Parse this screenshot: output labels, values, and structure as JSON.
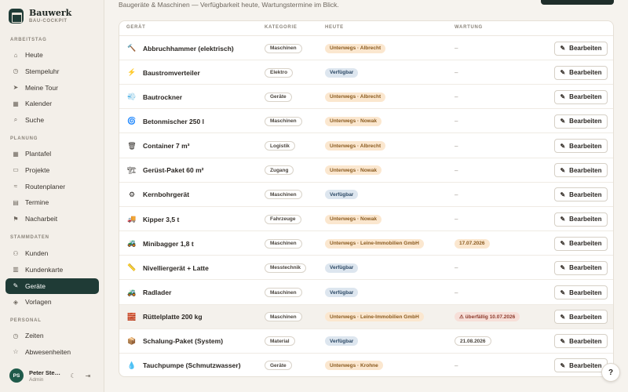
{
  "brand": {
    "title": "Bauwerk",
    "subtitle": "BAU-COCKPIT",
    "logo_icon": "building-icon"
  },
  "sidebar": {
    "sections": [
      {
        "label": "ARBEITSTAG",
        "items": [
          {
            "label": "Heute",
            "icon": "home-icon",
            "glyph": "⌂"
          },
          {
            "label": "Stempeluhr",
            "icon": "clock-icon",
            "glyph": "◷"
          },
          {
            "label": "Meine Tour",
            "icon": "send-icon",
            "glyph": "➤"
          },
          {
            "label": "Kalender",
            "icon": "calendar-icon",
            "glyph": "▦"
          },
          {
            "label": "Suche",
            "icon": "search-icon",
            "glyph": "⌕"
          }
        ]
      },
      {
        "label": "PLANUNG",
        "items": [
          {
            "label": "Plantafel",
            "icon": "grid-icon",
            "glyph": "▦"
          },
          {
            "label": "Projekte",
            "icon": "folder-icon",
            "glyph": "▭"
          },
          {
            "label": "Routenplaner",
            "icon": "route-icon",
            "glyph": "≈"
          },
          {
            "label": "Termine",
            "icon": "document-icon",
            "glyph": "▤"
          },
          {
            "label": "Nacharbeit",
            "icon": "flag-icon",
            "glyph": "⚑"
          }
        ]
      },
      {
        "label": "STAMMDATEN",
        "items": [
          {
            "label": "Kunden",
            "icon": "users-icon",
            "glyph": "⚇"
          },
          {
            "label": "Kundenkarte",
            "icon": "map-icon",
            "glyph": "▥"
          },
          {
            "label": "Geräte",
            "icon": "wrench-icon",
            "glyph": "✎",
            "active": true
          },
          {
            "label": "Vorlagen",
            "icon": "layers-icon",
            "glyph": "◈"
          }
        ]
      },
      {
        "label": "PERSONAL",
        "items": [
          {
            "label": "Zeiten",
            "icon": "clock-icon",
            "glyph": "◷"
          },
          {
            "label": "Abwesenheiten",
            "icon": "star-icon",
            "glyph": "☆"
          }
        ]
      }
    ]
  },
  "user": {
    "initials": "PS",
    "name": "Peter Ste…",
    "role": "Admin",
    "theme_icon": "moon-icon",
    "logout_icon": "logout-icon"
  },
  "intro": "Baugeräte & Maschinen — Verfügbarkeit heute, Wartungstermine im Blick.",
  "table": {
    "headers": {
      "device": "GERÄT",
      "category": "KATEGORIE",
      "today": "HEUTE",
      "maintenance": "WARTUNG"
    },
    "edit_label": "Bearbeiten",
    "rows": [
      {
        "icon": "🔨",
        "icon_name": "hammer-icon",
        "name": "Abbruchhammer (elektrisch)",
        "category": "Maschinen",
        "status": "Unterwegs · Albrecht",
        "status_type": "away",
        "maintenance": "–",
        "maint_type": "none"
      },
      {
        "icon": "⚡",
        "icon_name": "lightning-icon",
        "name": "Baustromverteiler",
        "category": "Elektro",
        "status": "Verfügbar",
        "status_type": "free",
        "maintenance": "–",
        "maint_type": "none"
      },
      {
        "icon": "💨",
        "icon_name": "dryer-icon",
        "name": "Bautrockner",
        "category": "Geräte",
        "status": "Unterwegs · Albrecht",
        "status_type": "away",
        "maintenance": "–",
        "maint_type": "none"
      },
      {
        "icon": "🌀",
        "icon_name": "mixer-icon",
        "name": "Betonmischer 250 l",
        "category": "Maschinen",
        "status": "Unterwegs · Nowak",
        "status_type": "away",
        "maintenance": "–",
        "maint_type": "none"
      },
      {
        "icon": "🗑",
        "icon_name": "container-icon",
        "name": "Container 7 m³",
        "category": "Logistik",
        "status": "Unterwegs · Albrecht",
        "status_type": "away",
        "maintenance": "–",
        "maint_type": "none"
      },
      {
        "icon": "🏗",
        "icon_name": "scaffold-icon",
        "name": "Gerüst-Paket 60 m²",
        "category": "Zugang",
        "status": "Unterwegs · Nowak",
        "status_type": "away",
        "maintenance": "–",
        "maint_type": "none"
      },
      {
        "icon": "⚙",
        "icon_name": "drill-icon",
        "name": "Kernbohrgerät",
        "category": "Maschinen",
        "status": "Verfügbar",
        "status_type": "free",
        "maintenance": "–",
        "maint_type": "none"
      },
      {
        "icon": "🚚",
        "icon_name": "truck-icon",
        "name": "Kipper 3,5 t",
        "category": "Fahrzeuge",
        "status": "Unterwegs · Nowak",
        "status_type": "away",
        "maintenance": "–",
        "maint_type": "none"
      },
      {
        "icon": "🚜",
        "icon_name": "excavator-icon",
        "name": "Minibagger 1,8 t",
        "category": "Maschinen",
        "status": "Unterwegs · Leine-Immobilien GmbH",
        "status_type": "away",
        "maintenance": "17.07.2026",
        "maint_type": "warn"
      },
      {
        "icon": "📏",
        "icon_name": "level-icon",
        "name": "Nivelliergerät + Latte",
        "category": "Messtechnik",
        "status": "Verfügbar",
        "status_type": "free",
        "maintenance": "–",
        "maint_type": "none"
      },
      {
        "icon": "🚜",
        "icon_name": "loader-icon",
        "name": "Radlader",
        "category": "Maschinen",
        "status": "Verfügbar",
        "status_type": "free",
        "maintenance": "–",
        "maint_type": "none"
      },
      {
        "icon": "🧱",
        "icon_name": "plate-icon",
        "name": "Rüttelplatte 200 kg",
        "category": "Maschinen",
        "status": "Unterwegs · Leine-Immobilien GmbH",
        "status_type": "away",
        "maintenance": "⚠ überfällig 10.07.2026",
        "maint_type": "due",
        "highlight": true
      },
      {
        "icon": "📦",
        "icon_name": "box-icon",
        "name": "Schalung-Paket (System)",
        "category": "Material",
        "status": "Verfügbar",
        "status_type": "free",
        "maintenance": "21.08.2026",
        "maint_type": "plain"
      },
      {
        "icon": "💧",
        "icon_name": "water-drop-icon",
        "name": "Tauchpumpe (Schmutzwasser)",
        "category": "Geräte",
        "status": "Unterwegs · Krohne",
        "status_type": "away",
        "maintenance": "–",
        "maint_type": "none"
      }
    ]
  },
  "help": {
    "label": "?",
    "icon": "help-icon"
  }
}
